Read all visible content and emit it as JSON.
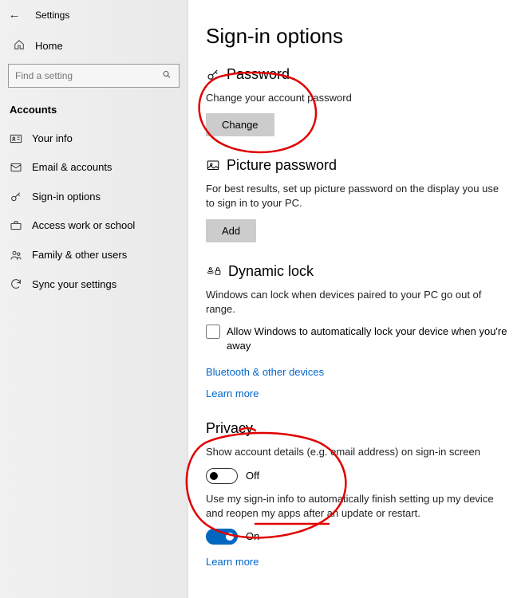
{
  "window_title": "Settings",
  "home_label": "Home",
  "search_placeholder": "Find a setting",
  "category": "Accounts",
  "nav": [
    {
      "label": "Your info"
    },
    {
      "label": "Email & accounts"
    },
    {
      "label": "Sign-in options"
    },
    {
      "label": "Access work or school"
    },
    {
      "label": "Family & other users"
    },
    {
      "label": "Sync your settings"
    }
  ],
  "page_title": "Sign-in options",
  "password": {
    "heading": "Password",
    "desc": "Change your account password",
    "button": "Change"
  },
  "picture_password": {
    "heading": "Picture password",
    "desc": "For best results, set up picture password on the display you use to sign in to your PC.",
    "button": "Add"
  },
  "dynamic_lock": {
    "heading": "Dynamic lock",
    "desc": "Windows can lock when devices paired to your PC go out of range.",
    "checkbox_label": "Allow Windows to automatically lock your device when you're away",
    "link1": "Bluetooth & other devices",
    "link2": "Learn more"
  },
  "privacy": {
    "heading": "Privacy",
    "toggle1_desc": "Show account details (e.g. email address) on sign-in screen",
    "toggle1_state": "Off",
    "toggle2_desc": "Use my sign-in info to automatically finish setting up my device and reopen my apps after an update or restart.",
    "toggle2_state": "On",
    "link": "Learn more"
  }
}
